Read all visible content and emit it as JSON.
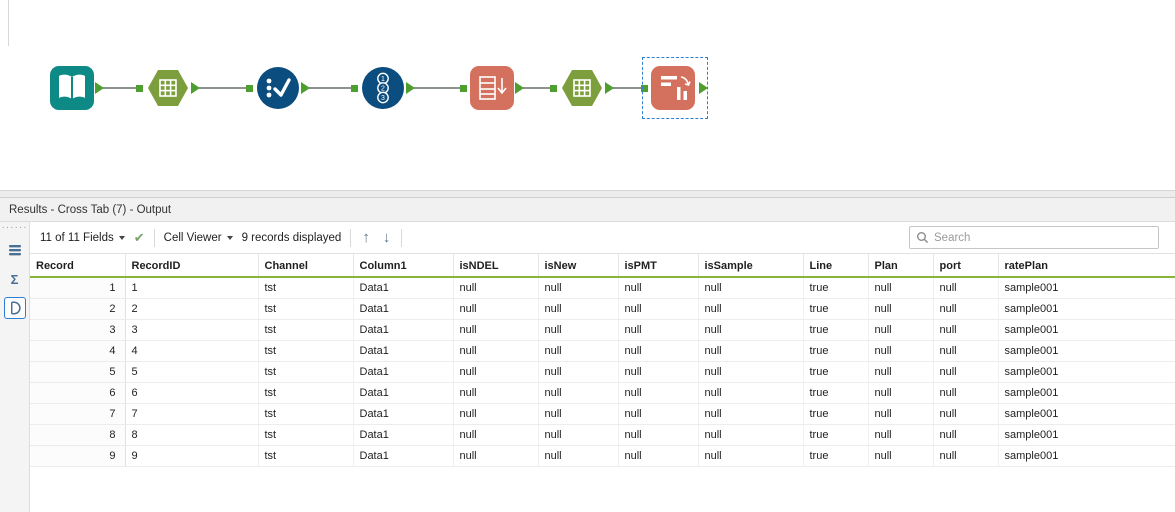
{
  "canvas": {
    "tools": [
      {
        "name": "input-data-tool",
        "color": "#0d8a85"
      },
      {
        "name": "summarize-tool",
        "color": "#7d9e3c"
      },
      {
        "name": "select-tool",
        "color": "#0a4d7e"
      },
      {
        "name": "record-id-tool",
        "color": "#0a4d7e",
        "badges": [
          "1",
          "2",
          "3"
        ]
      },
      {
        "name": "transpose-tool",
        "color": "#d4705e"
      },
      {
        "name": "summarize-tool-2",
        "color": "#7d9e3c"
      },
      {
        "name": "cross-tab-tool",
        "color": "#d4705e",
        "selected": true
      }
    ],
    "connector_green": "#4f9f30",
    "selection_blue": "#2f7ed0"
  },
  "icons": {
    "drag_dots": "······",
    "sigma": "Σ",
    "check": "✔",
    "arrow_up": "↑",
    "arrow_down": "↓"
  },
  "results": {
    "title": "Results - Cross Tab (7) - Output",
    "toolbar": {
      "fields_dropdown": "11 of 11 Fields",
      "cell_viewer_dropdown": "Cell Viewer",
      "records_displayed": "9 records displayed",
      "search_placeholder": "Search"
    },
    "table": {
      "header_underline_color": "#86b53a",
      "columns": [
        "Record",
        "RecordID",
        "Channel",
        "Column1",
        "isNDEL",
        "isNew",
        "isPMT",
        "isSample",
        "Line",
        "Plan",
        "port",
        "ratePlan"
      ],
      "rows": [
        [
          "1",
          "1",
          "tst",
          "Data1",
          "null",
          "null",
          "null",
          "null",
          "true",
          "null",
          "null",
          "sample001"
        ],
        [
          "2",
          "2",
          "tst",
          "Data1",
          "null",
          "null",
          "null",
          "null",
          "true",
          "null",
          "null",
          "sample001"
        ],
        [
          "3",
          "3",
          "tst",
          "Data1",
          "null",
          "null",
          "null",
          "null",
          "true",
          "null",
          "null",
          "sample001"
        ],
        [
          "4",
          "4",
          "tst",
          "Data1",
          "null",
          "null",
          "null",
          "null",
          "true",
          "null",
          "null",
          "sample001"
        ],
        [
          "5",
          "5",
          "tst",
          "Data1",
          "null",
          "null",
          "null",
          "null",
          "true",
          "null",
          "null",
          "sample001"
        ],
        [
          "6",
          "6",
          "tst",
          "Data1",
          "null",
          "null",
          "null",
          "null",
          "true",
          "null",
          "null",
          "sample001"
        ],
        [
          "7",
          "7",
          "tst",
          "Data1",
          "null",
          "null",
          "null",
          "null",
          "true",
          "null",
          "null",
          "sample001"
        ],
        [
          "8",
          "8",
          "tst",
          "Data1",
          "null",
          "null",
          "null",
          "null",
          "true",
          "null",
          "null",
          "sample001"
        ],
        [
          "9",
          "9",
          "tst",
          "Data1",
          "null",
          "null",
          "null",
          "null",
          "true",
          "null",
          "null",
          "sample001"
        ]
      ]
    }
  }
}
